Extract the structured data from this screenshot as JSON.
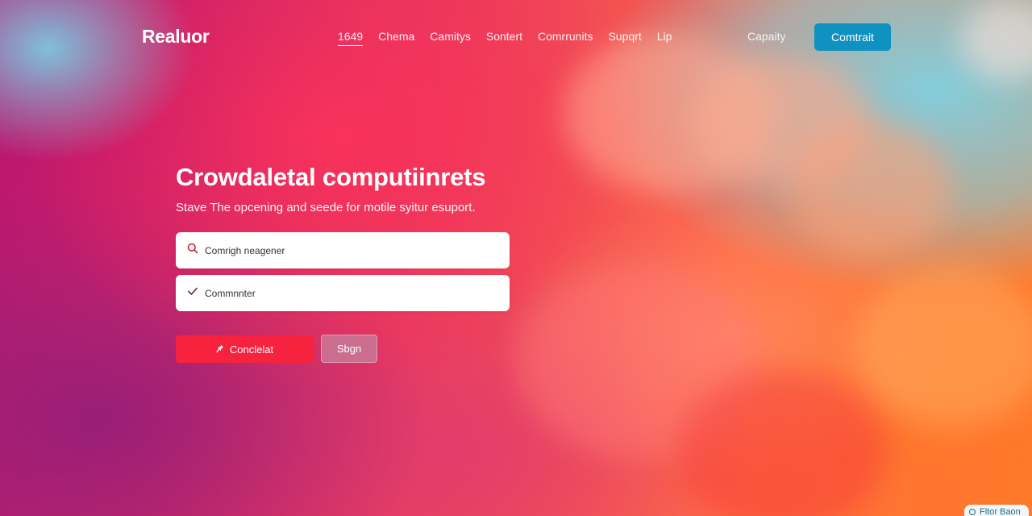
{
  "brand": {
    "logo_text": "Realuor"
  },
  "nav": {
    "links": [
      {
        "label": "1649",
        "active": true
      },
      {
        "label": "Chema"
      },
      {
        "label": "Camitys"
      },
      {
        "label": "Sontert"
      },
      {
        "label": "Comrrunits"
      },
      {
        "label": "Supqrt"
      },
      {
        "label": "Lip"
      }
    ],
    "right_link": "Capaity",
    "cta_label": "Comtrait"
  },
  "hero": {
    "title": "Crowdaletal computiinrets",
    "subtitle": "Stave The opcening and seede for motile syitur esuport."
  },
  "form": {
    "field1": {
      "placeholder": "Comrigh neagener",
      "icon": "search-icon"
    },
    "field2": {
      "placeholder": "Commnnter",
      "icon": "check-icon"
    },
    "primary_button": {
      "label": "Conclelat",
      "icon": "pin-icon"
    },
    "secondary_button": {
      "label": "Sbgn"
    }
  },
  "corner_badge": {
    "label": "Fltor Baon",
    "icon": "circle-icon"
  },
  "colors": {
    "cta_blue": "#0f92c0",
    "primary_red": "#f7223e",
    "secondary_pink": "#c87896",
    "icon_red": "#c0283c"
  }
}
